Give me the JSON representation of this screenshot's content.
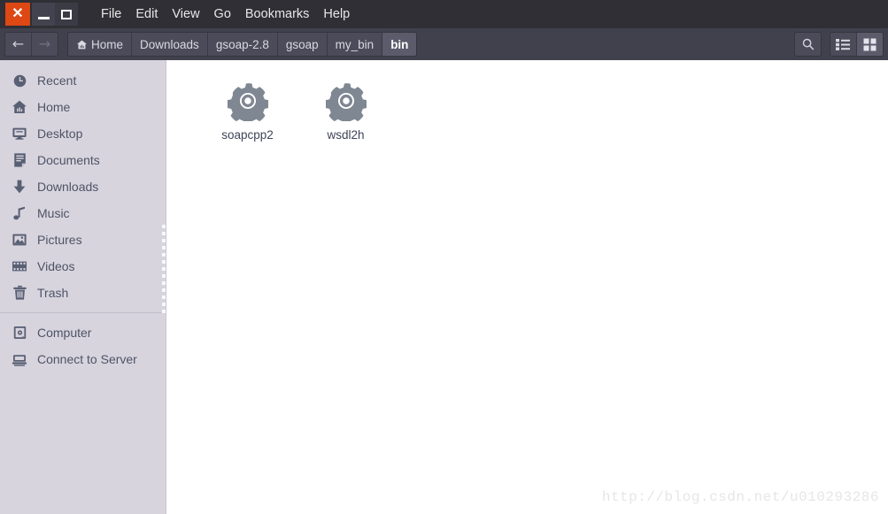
{
  "window": {
    "controls": {
      "close_label": "✕",
      "close_name": "close",
      "minimize_name": "minimize",
      "maximize_name": "maximize",
      "close_color": "#dd4814"
    },
    "menu": [
      {
        "label": "File"
      },
      {
        "label": "Edit"
      },
      {
        "label": "View"
      },
      {
        "label": "Go"
      },
      {
        "label": "Bookmarks"
      },
      {
        "label": "Help"
      }
    ]
  },
  "toolbar": {
    "back_glyph": "←",
    "forward_glyph": "→",
    "back_enabled": "true",
    "forward_enabled": "false",
    "breadcrumbs": [
      {
        "label": "Home",
        "icon": "home-icon",
        "active": false
      },
      {
        "label": "Downloads",
        "icon": "",
        "active": false
      },
      {
        "label": "gsoap-2.8",
        "icon": "",
        "active": false
      },
      {
        "label": "gsoap",
        "icon": "",
        "active": false
      },
      {
        "label": "my_bin",
        "icon": "",
        "active": false
      },
      {
        "label": "bin",
        "icon": "",
        "active": true
      }
    ],
    "search_icon": "search-icon",
    "view_list_icon": "list-view-icon",
    "view_grid_icon": "grid-view-icon",
    "active_view": "grid"
  },
  "sidebar": {
    "background": "#d7d4de",
    "items": [
      {
        "label": "Recent",
        "icon": "clock-icon"
      },
      {
        "label": "Home",
        "icon": "home-icon"
      },
      {
        "label": "Desktop",
        "icon": "monitor-icon"
      },
      {
        "label": "Documents",
        "icon": "document-icon"
      },
      {
        "label": "Downloads",
        "icon": "download-arrow-icon"
      },
      {
        "label": "Music",
        "icon": "music-note-icon"
      },
      {
        "label": "Pictures",
        "icon": "picture-icon"
      },
      {
        "label": "Videos",
        "icon": "film-icon"
      },
      {
        "label": "Trash",
        "icon": "trash-icon"
      }
    ],
    "items_bottom": [
      {
        "label": "Computer",
        "icon": "computer-icon"
      },
      {
        "label": "Connect to Server",
        "icon": "server-icon"
      }
    ]
  },
  "main": {
    "files": [
      {
        "name": "soapcpp2",
        "icon": "gear-executable-icon"
      },
      {
        "name": "wsdl2h",
        "icon": "gear-executable-icon"
      }
    ],
    "watermark": "http://blog.csdn.net/u010293286"
  }
}
